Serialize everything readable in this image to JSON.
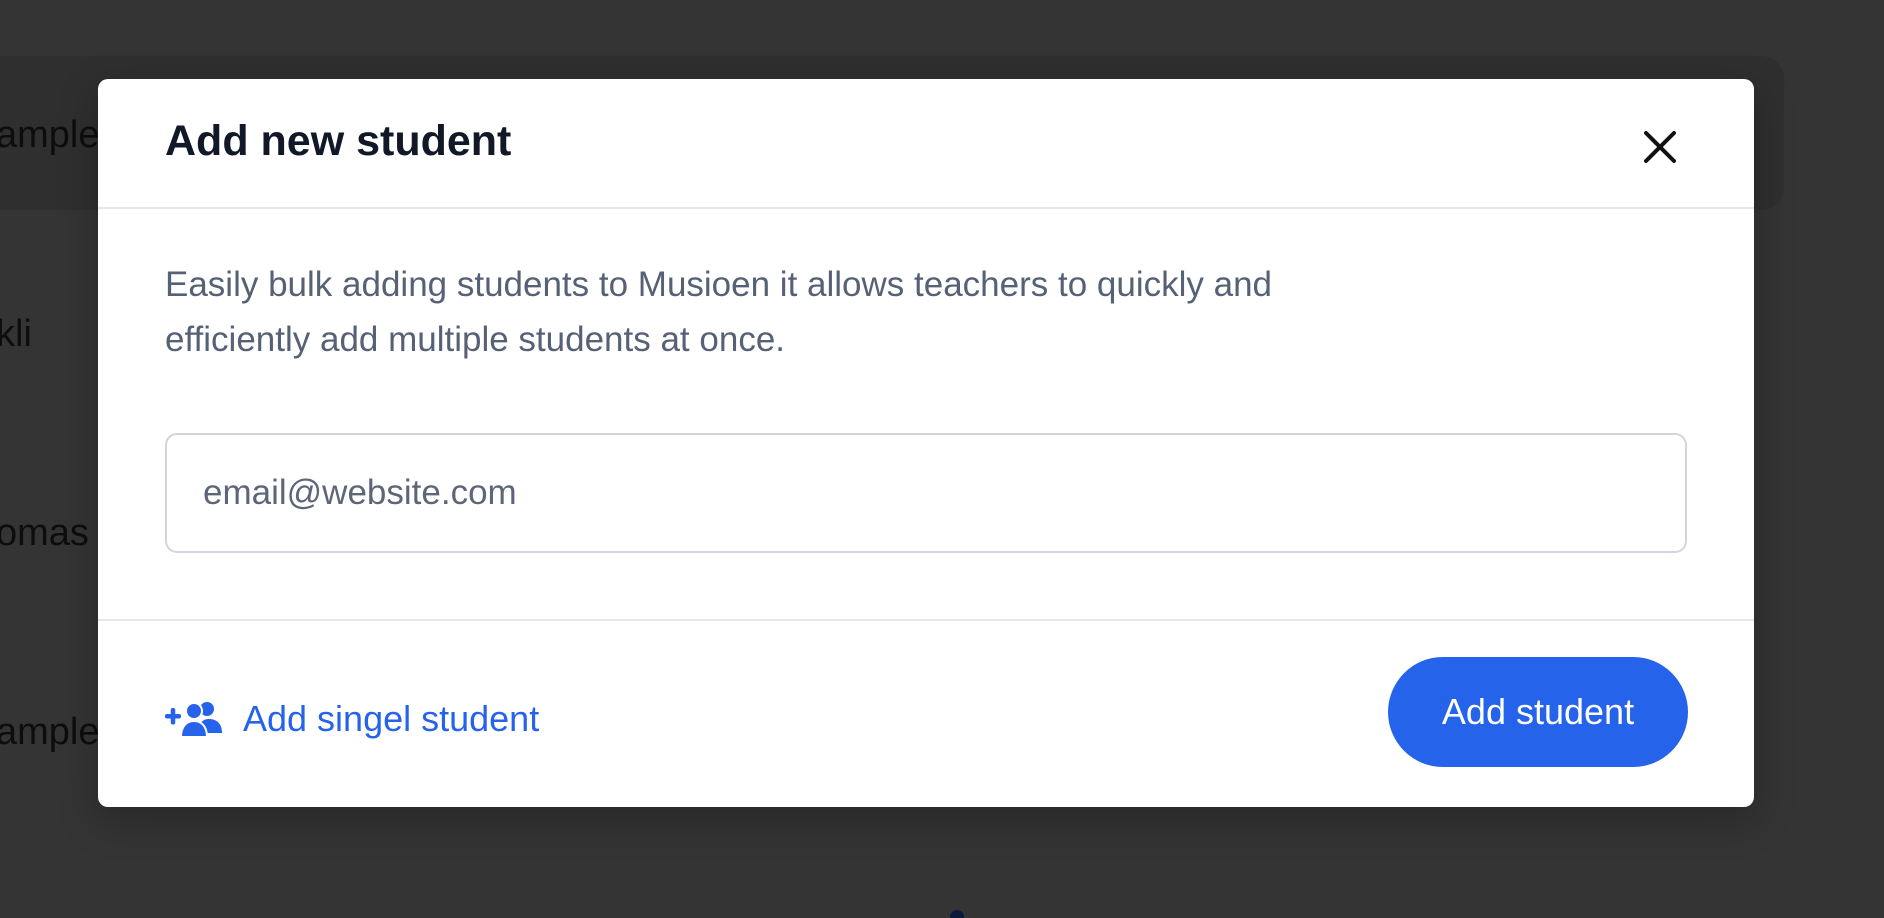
{
  "background": {
    "rows": [
      "ample",
      "kli",
      "omas",
      "ample"
    ]
  },
  "modal": {
    "title": "Add new student",
    "close_icon": "close-icon",
    "description": "Easily bulk adding students to Musioen it allows teachers to quickly and efficiently add multiple students at once.",
    "email_input": {
      "value": "",
      "placeholder": "email@website.com"
    },
    "footer": {
      "add_single_label": "Add singel student",
      "add_single_icon": "add-user-group-icon",
      "primary_button_label": "Add student"
    }
  },
  "colors": {
    "accent": "#2563eb",
    "overlay": "#343434",
    "title": "#111827",
    "muted_text": "#566176"
  }
}
